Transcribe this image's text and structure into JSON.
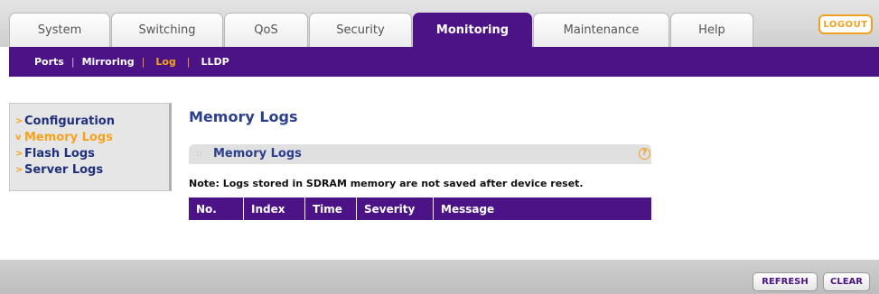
{
  "tabs": [
    {
      "label": "System"
    },
    {
      "label": "Switching"
    },
    {
      "label": "QoS"
    },
    {
      "label": "Security"
    },
    {
      "label": "Monitoring",
      "active": true
    },
    {
      "label": "Maintenance"
    },
    {
      "label": "Help"
    }
  ],
  "logout_label": "LOGOUT",
  "subnav": {
    "items": [
      {
        "label": "Ports"
      },
      {
        "label": "Mirroring"
      },
      {
        "label": "Log",
        "active": true
      },
      {
        "label": "LLDP"
      }
    ]
  },
  "sidemenu": {
    "items": [
      {
        "label": "Configuration",
        "bullet": ">"
      },
      {
        "label": "Memory Logs",
        "bullet": "v",
        "active": true
      },
      {
        "label": "Flash Logs",
        "bullet": ">"
      },
      {
        "label": "Server Logs",
        "bullet": ">"
      }
    ]
  },
  "main": {
    "title": "Memory Logs",
    "panel_title": "Memory Logs",
    "help_icon": "?",
    "note": "Note: Logs stored in SDRAM memory are not saved after device reset.",
    "columns": [
      "No.",
      "Index",
      "Time",
      "Severity",
      "Message"
    ]
  },
  "footer": {
    "refresh_label": "REFRESH",
    "clear_label": "CLEAR"
  },
  "colors": {
    "accent_purple": "#4c1387",
    "accent_orange": "#f3a41f",
    "link_blue": "#2b3f8c"
  }
}
